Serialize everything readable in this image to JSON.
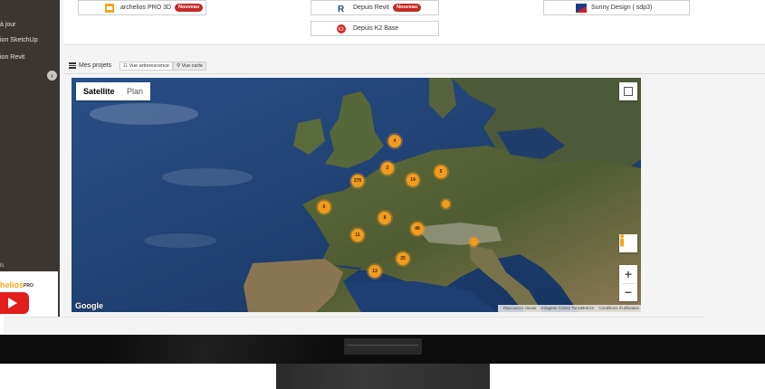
{
  "sidebar": {
    "items": [
      {
        "label": "à jour"
      },
      {
        "label": "ion SketchUp"
      },
      {
        "label": "ion Revit"
      }
    ],
    "toggle_icon": "chevron-left-icon",
    "bottom_label": "ls",
    "promo": {
      "brand": "helios",
      "brand_suffix": "PRO",
      "video_icon": "youtube-play-icon"
    }
  },
  "software": {
    "cards": [
      {
        "label": "archelios PRO 3D",
        "icon": "archelios-icon",
        "badge": "Nouveau"
      },
      {
        "label": "Depuis Revit",
        "icon": "revit-icon",
        "badge": "Nouveau"
      },
      {
        "label": "Sunny Design ( sdp3)",
        "icon": "sma-icon",
        "badge": ""
      },
      {
        "label": "Depuis K2 Base",
        "icon": "k2-icon",
        "badge": ""
      }
    ]
  },
  "projects": {
    "title": "Mes projets",
    "tabs": [
      {
        "label": "Vue arborescence",
        "icon": "tree-icon",
        "active": false
      },
      {
        "label": "Vue carte",
        "icon": "map-pin-icon",
        "active": true
      }
    ]
  },
  "map": {
    "type_buttons": [
      {
        "label": "Satellite",
        "selected": true
      },
      {
        "label": "Plan",
        "selected": false
      }
    ],
    "zoom_in": "+",
    "zoom_out": "−",
    "logo": "Google",
    "attribution": [
      "Raccourcis clavier",
      "Imagerie ©2022 TerraMetrics",
      "Conditions d'utilisation"
    ],
    "clusters": [
      {
        "count": "4"
      },
      {
        "count": "2"
      },
      {
        "count": "275"
      },
      {
        "count": "14"
      },
      {
        "count": "5"
      },
      {
        "count": ""
      },
      {
        "count": "6"
      },
      {
        "count": "8"
      },
      {
        "count": "46"
      },
      {
        "count": "11"
      },
      {
        "count": ""
      },
      {
        "count": "25"
      },
      {
        "count": "13"
      }
    ]
  }
}
